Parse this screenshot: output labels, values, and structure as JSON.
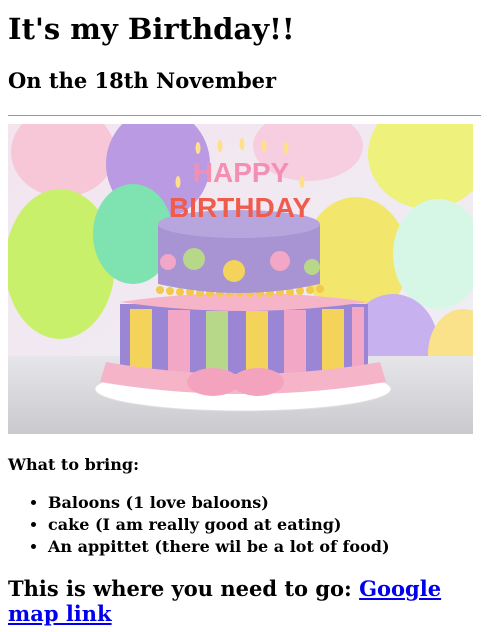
{
  "title": "It's my Birthday!!",
  "subtitle": "On the 18th November",
  "image": {
    "icon": "birthday-cake-image",
    "cake_text_top": "HAPPY",
    "cake_text_bottom": "BIRTHDAY",
    "colors": {
      "top_tier": "#a894d2",
      "bottom_tier_purple": "#9a86d4",
      "stripe_yellow": "#f3d35a",
      "stripe_pink": "#f2a7c6",
      "stripe_green": "#b8d889",
      "bow": "#f6b4c8"
    }
  },
  "bring": {
    "heading": "What to bring:",
    "items": [
      "Baloons (1 love baloons)",
      "cake (I am really good at eating)",
      "An appittet (there wil be a lot of food)"
    ]
  },
  "directions": {
    "text": "This is where you need to go:",
    "link_text": "Google map link"
  }
}
